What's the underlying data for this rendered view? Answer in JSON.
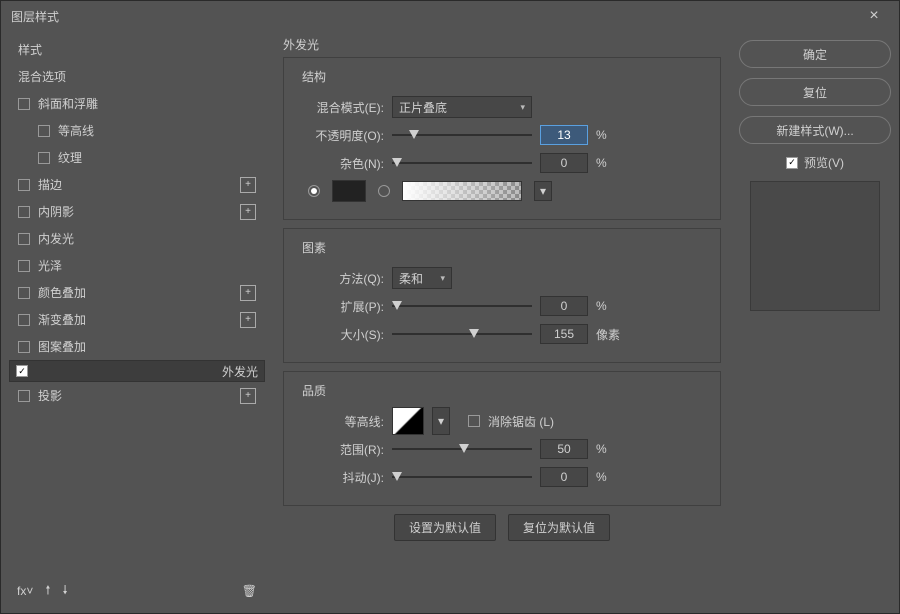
{
  "title": "图层样式",
  "styles": {
    "hdr1": "样式",
    "hdr2": "混合选项",
    "bevel": "斜面和浮雕",
    "contour": "等高线",
    "texture": "纹理",
    "stroke": "描边",
    "innerShadow": "内阴影",
    "innerGlow": "内发光",
    "satin": "光泽",
    "colorOverlay": "颜色叠加",
    "gradOverlay": "渐变叠加",
    "patOverlay": "图案叠加",
    "outerGlow": "外发光",
    "dropShadow": "投影"
  },
  "main": {
    "title": "外发光",
    "g1": "结构",
    "g2": "图素",
    "g3": "品质",
    "blendLabel": "混合模式(E):",
    "blendValue": "正片叠底",
    "opacityLabel": "不透明度(O):",
    "opacityVal": "13",
    "pct": "%",
    "noiseLabel": "杂色(N):",
    "noiseVal": "0",
    "methodLabel": "方法(Q):",
    "methodValue": "柔和",
    "spreadLabel": "扩展(P):",
    "spreadVal": "0",
    "sizeLabel": "大小(S):",
    "sizeVal": "155",
    "px": "像素",
    "contourLabel": "等高线:",
    "antiAlias": "消除锯齿 (L)",
    "rangeLabel": "范围(R):",
    "rangeVal": "50",
    "jitterLabel": "抖动(J):",
    "jitterVal": "0",
    "setDefault": "设置为默认值",
    "resetDefault": "复位为默认值"
  },
  "right": {
    "ok": "确定",
    "cancel": "复位",
    "newStyle": "新建样式(W)...",
    "preview": "预览(V)"
  }
}
